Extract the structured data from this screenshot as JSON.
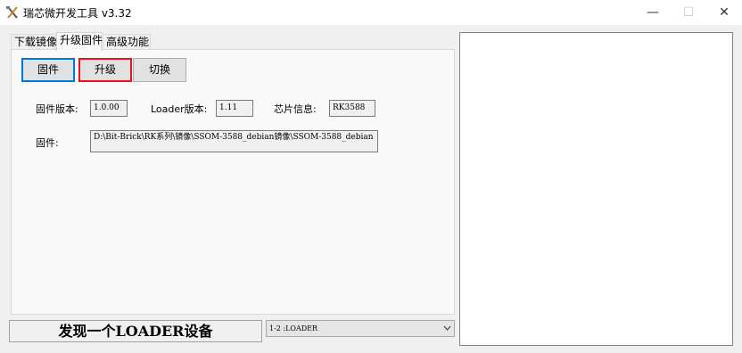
{
  "window": {
    "title": "瑞芯微开发工具 v3.32",
    "app_icon": "tools-icon",
    "minimize_glyph": "—",
    "maximize_glyph": "☐",
    "close_glyph": "✕"
  },
  "tabs": [
    {
      "label": "下载镜像"
    },
    {
      "label": "升级固件"
    },
    {
      "label": "高级功能"
    }
  ],
  "buttons": {
    "firmware": "固件",
    "upgrade": "升级",
    "switch": "切换"
  },
  "info": {
    "firmware_version_label": "固件版本:",
    "firmware_version_value": "1.0.00",
    "loader_version_label": "Loader版本:",
    "loader_version_value": "1.11",
    "chip_info_label": "芯片信息:",
    "chip_info_value": "RK3588",
    "firmware_path_label": "固件:",
    "firmware_path_value": "D:\\Bit-Brick\\RK系列\\镜像\\SSOM-3588_debian镜像\\SSOM-3588_debian"
  },
  "status": {
    "message": "发现一个LOADER设备",
    "device_selected": "1-2 :LOADER"
  },
  "colors": {
    "focus_blue": "#0078d7",
    "highlight_red": "#e81123"
  }
}
